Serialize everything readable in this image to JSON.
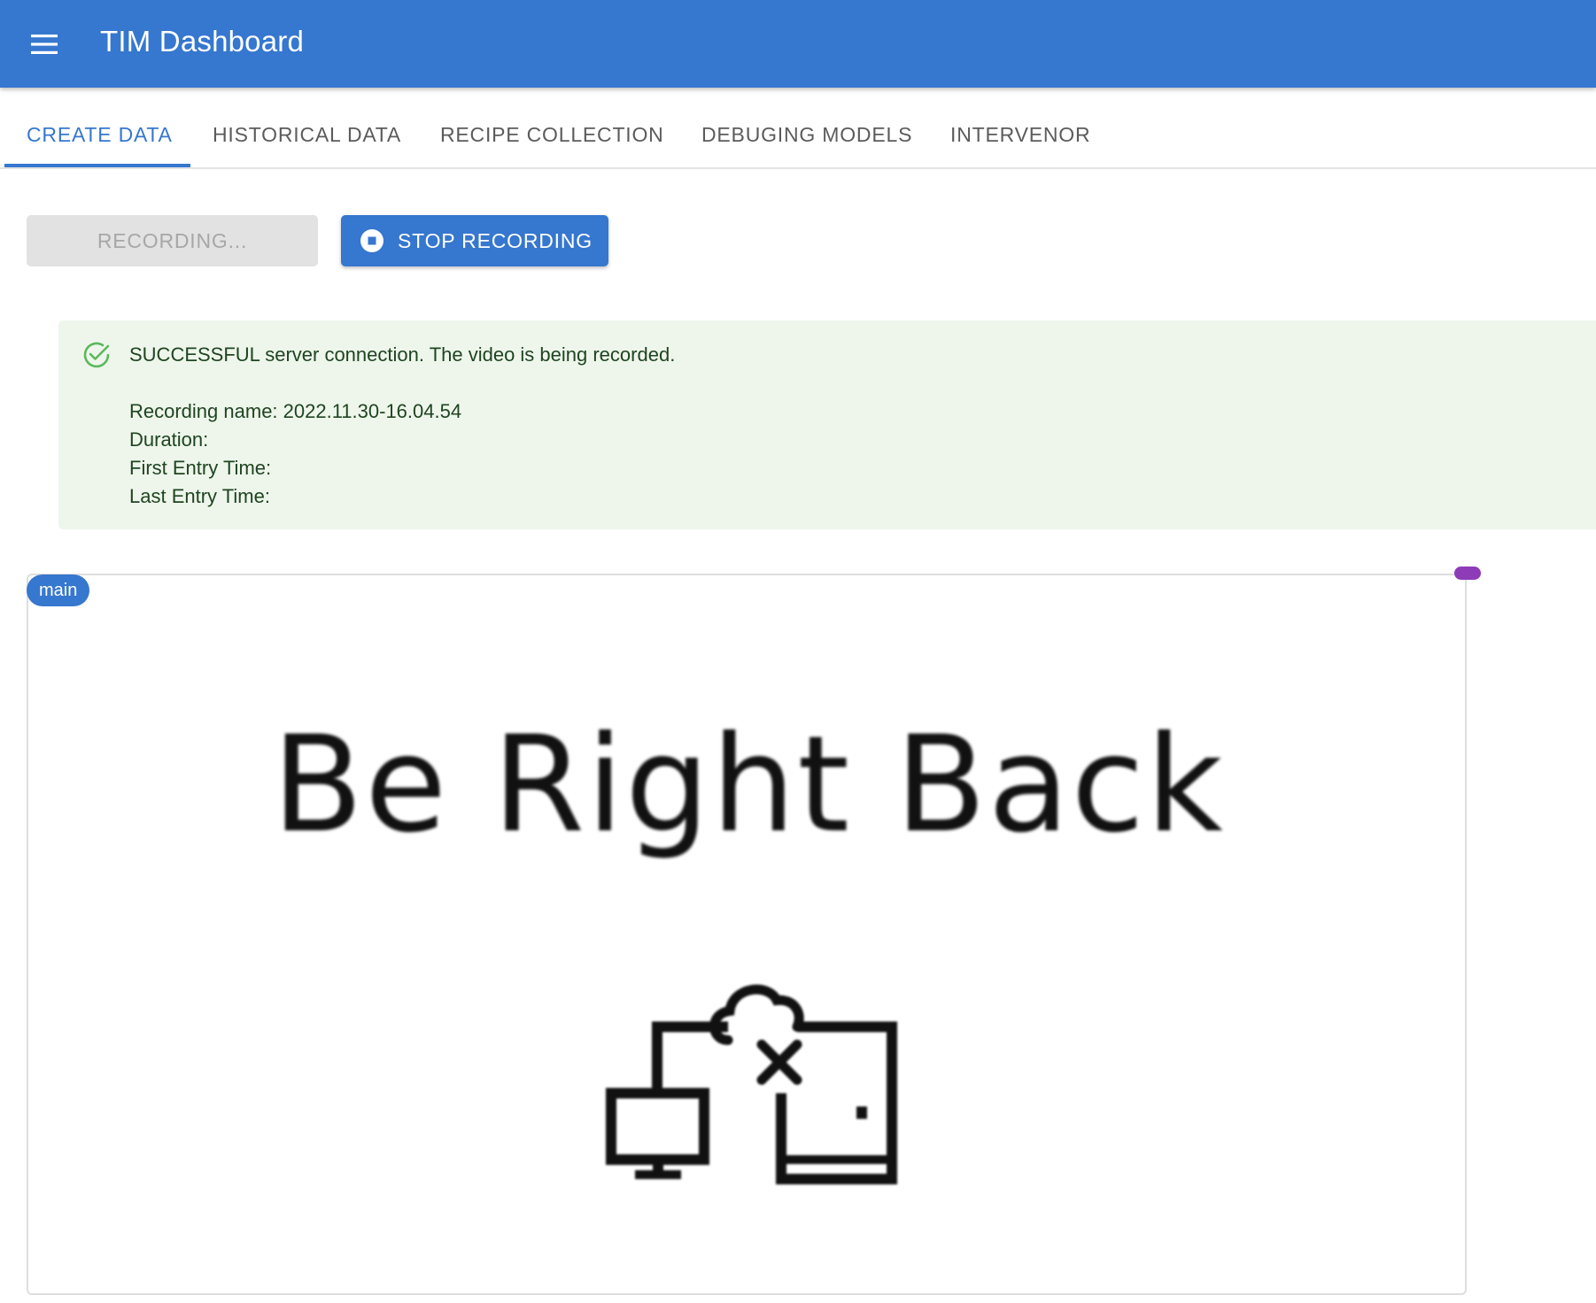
{
  "app": {
    "title": "TIM Dashboard"
  },
  "tabs": [
    {
      "label": "CREATE DATA",
      "active": true
    },
    {
      "label": "HISTORICAL DATA",
      "active": false
    },
    {
      "label": "RECIPE COLLECTION",
      "active": false
    },
    {
      "label": "DEBUGING MODELS",
      "active": false
    },
    {
      "label": "INTERVENOR",
      "active": false
    }
  ],
  "controls": {
    "recording_label": "RECORDING...",
    "stop_label": "STOP RECORDING"
  },
  "alert": {
    "message": "SUCCESSFUL server connection. The video is being recorded.",
    "recording_name": "Recording name: 2022.11.30-16.04.54",
    "duration": "Duration:",
    "first_entry": "First Entry Time:",
    "last_entry": "Last Entry Time:"
  },
  "video": {
    "chip_label": "main",
    "overlay_text": "Be Right Back"
  },
  "colors": {
    "primary": "#3677cf",
    "success_bg": "#eef6ec",
    "success_icon": "#5cb85c",
    "handle": "#8e3bb8"
  },
  "icons": {
    "menu": "hamburger-menu-icon",
    "stop": "stop-circle-icon",
    "success": "check-circle-icon",
    "brb": "computer-cloud-disconnected-icon"
  }
}
